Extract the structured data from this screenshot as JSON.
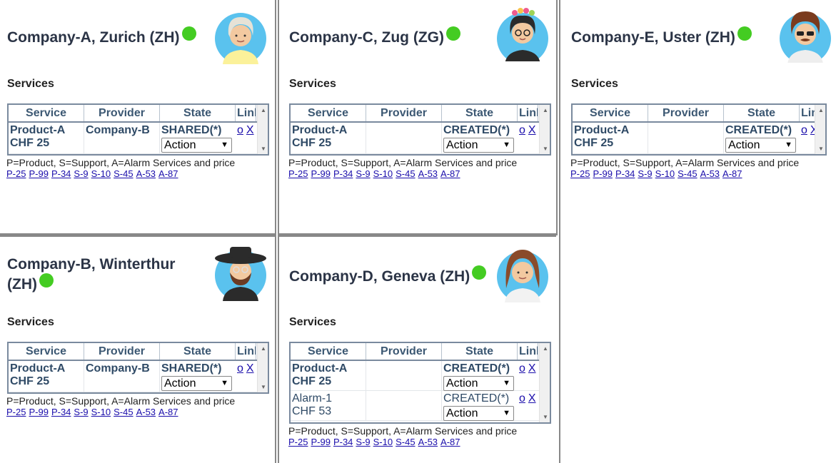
{
  "services_label": "Services",
  "legend": "P=Product, S=Support, A=Alarm Services and price",
  "codes": [
    "P-25",
    "P-99",
    "P-34",
    "S-9",
    "S-10",
    "S-45",
    "A-53",
    "A-87"
  ],
  "table_headers": {
    "service": "Service",
    "provider": "Provider",
    "state": "State",
    "link": "Link"
  },
  "action_label": "Action",
  "link_o": "o",
  "link_x": "X",
  "status_color": "#44cc22",
  "cards": {
    "a": {
      "title": "Company-A, Zurich (ZH)",
      "rows": [
        {
          "service": "Product-A",
          "price": "CHF 25",
          "provider": "Company-B",
          "state": "SHARED(*)"
        }
      ]
    },
    "b": {
      "title_line1": "Company-B, Winterthur",
      "title_line2": "(ZH)",
      "rows": [
        {
          "service": "Product-A",
          "price": "CHF 25",
          "provider": "Company-B",
          "state": "SHARED(*)"
        }
      ]
    },
    "c": {
      "title": "Company-C, Zug (ZG)",
      "rows": [
        {
          "service": "Product-A",
          "price": "CHF 25",
          "provider": "",
          "state": "CREATED(*)"
        }
      ]
    },
    "d": {
      "title": "Company-D, Geneva (ZH)",
      "rows": [
        {
          "service": "Product-A",
          "price": "CHF 25",
          "provider": "",
          "state": "CREATED(*)"
        },
        {
          "service": "Alarm-1",
          "price": "CHF 53",
          "provider": "",
          "state": "CREATED(*)"
        }
      ]
    },
    "e": {
      "title": "Company-E, Uster (ZH)",
      "rows": [
        {
          "service": "Product-A",
          "price": "CHF 25",
          "provider": "",
          "state": "CREATED(*)"
        }
      ]
    }
  }
}
